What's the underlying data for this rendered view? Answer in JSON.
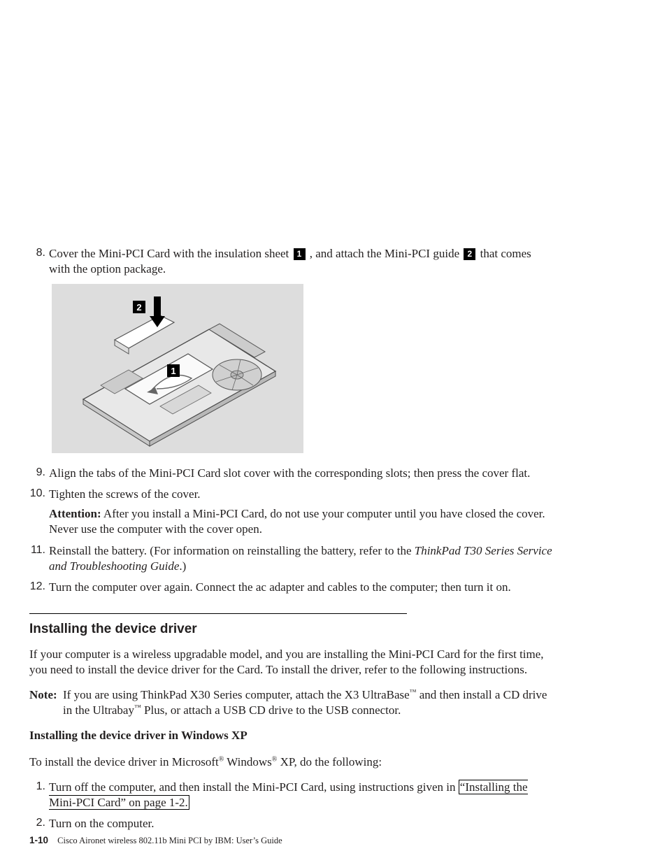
{
  "steps_a": [
    {
      "n": "8.",
      "pre": "Cover the Mini-PCI Card with the insulation sheet ",
      "c1": "1",
      "mid": " , and attach the Mini-PCI guide ",
      "c2": "2",
      "post": " that comes with the option package."
    }
  ],
  "steps_b": [
    {
      "n": "9.",
      "text": "Align the tabs of the Mini-PCI Card slot cover with the corresponding slots; then press the cover flat."
    },
    {
      "n": "10.",
      "text": "Tighten the screws of the cover.",
      "attn_label": "Attention:",
      "attn_text": "   After you install a Mini-PCI Card, do not use your computer until you have closed the cover. Never use the computer with the cover open."
    },
    {
      "n": "11.",
      "text_pre": "Reinstall the battery. (For information on reinstalling the battery, refer to the ",
      "text_em": "ThinkPad T30 Series Service and Troubleshooting Guide",
      "text_post": ".)"
    },
    {
      "n": "12.",
      "text": "Turn the computer over again. Connect the ac adapter and cables to the computer; then turn it on."
    }
  ],
  "section_title": "Installing the device driver",
  "intro": "If your computer is a wireless upgradable model, and you are installing the Mini-PCI Card for the first time, you need to install the device driver for the Card. To install the driver, refer to the following instructions.",
  "note_label": "Note:",
  "note_parts": {
    "a": "If you are using ThinkPad X30 Series computer, attach the X3 UltraBase",
    "tm": "™",
    "b": " and then install a CD drive in the Ultrabay",
    "c": " Plus, or attach a USB CD drive to the USB connector."
  },
  "subhead": "Installing the device driver in Windows XP",
  "install_lead": {
    "a": "To install the device driver in Microsoft",
    "reg": "®",
    "b": " Windows",
    "c": " XP, do the following:"
  },
  "install_steps": [
    {
      "n": "1.",
      "pre": "Turn off the computer, and then install the Mini-PCI Card, using instructions given in ",
      "link": "“Installing the Mini-PCI Card” on page 1-2.",
      "post": ""
    },
    {
      "n": "2.",
      "text": "Turn on the computer."
    }
  ],
  "footer": {
    "page": "1-10",
    "doc": "Cisco Aironet wireless 802.11b Mini PCI by IBM:  User’s Guide"
  },
  "figure": {
    "callout1": "1",
    "callout2": "2"
  }
}
